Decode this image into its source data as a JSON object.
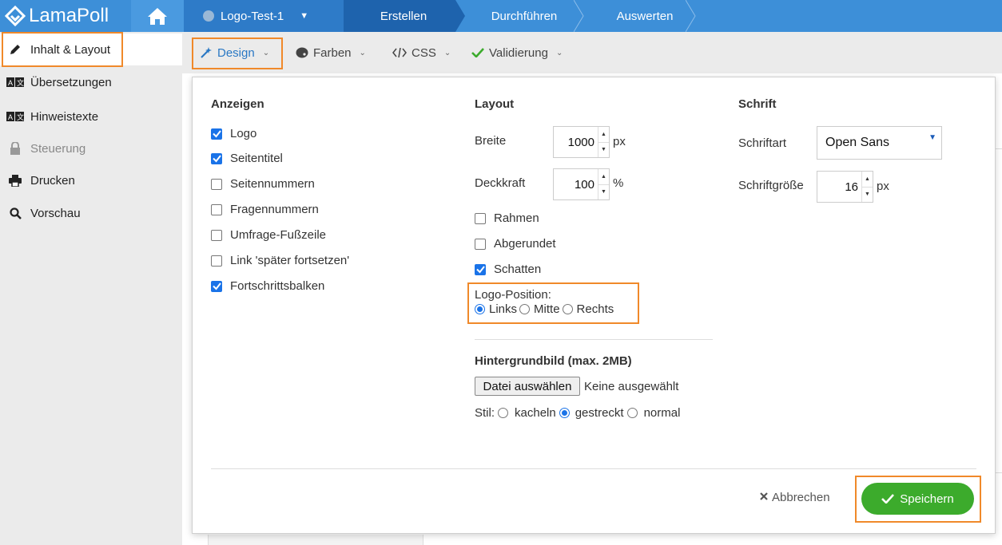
{
  "app": {
    "logo_text": "LamaPoll"
  },
  "breadcrumb": {
    "survey": "Logo-Test-1",
    "steps": [
      "Erstellen",
      "Durchführen",
      "Auswerten"
    ]
  },
  "sidebar": {
    "items": [
      {
        "label": "Inhalt & Layout",
        "icon": "pencil-icon"
      },
      {
        "label": "Übersetzungen",
        "icon": "translate-icon"
      },
      {
        "label": "Hinweistexte",
        "icon": "translate-icon"
      },
      {
        "label": "Steuerung",
        "icon": "lock-icon"
      },
      {
        "label": "Drucken",
        "icon": "printer-icon"
      },
      {
        "label": "Vorschau",
        "icon": "search-icon"
      }
    ]
  },
  "tools": {
    "design": "Design",
    "farben": "Farben",
    "css": "CSS",
    "validierung": "Validierung"
  },
  "anzeigen": {
    "heading": "Anzeigen",
    "options": [
      {
        "label": "Logo",
        "checked": true
      },
      {
        "label": "Seitentitel",
        "checked": true
      },
      {
        "label": "Seitennummern",
        "checked": false
      },
      {
        "label": "Fragennummern",
        "checked": false
      },
      {
        "label": "Umfrage-Fußzeile",
        "checked": false
      },
      {
        "label": "Link 'später fortsetzen'",
        "checked": false
      },
      {
        "label": "Fortschrittsbalken",
        "checked": true
      }
    ]
  },
  "layout": {
    "heading": "Layout",
    "breite_label": "Breite",
    "breite_value": "1000",
    "breite_unit": "px",
    "deckkraft_label": "Deckkraft",
    "deckkraft_value": "100",
    "deckkraft_unit": "%",
    "checks": [
      {
        "label": "Rahmen",
        "checked": false
      },
      {
        "label": "Abgerundet",
        "checked": false
      },
      {
        "label": "Schatten",
        "checked": true
      }
    ],
    "logo_position_label": "Logo-Position:",
    "logo_position_options": [
      "Links",
      "Mitte",
      "Rechts"
    ],
    "logo_position_selected": "Links",
    "hintergrund_heading": "Hintergrundbild (max. 2MB)",
    "file_button": "Datei auswählen",
    "file_status": "Keine ausgewählt",
    "stil_label": "Stil:",
    "stil_options": [
      "kacheln",
      "gestreckt",
      "normal"
    ],
    "stil_selected": "gestreckt"
  },
  "schrift": {
    "heading": "Schrift",
    "schriftart_label": "Schriftart",
    "schriftart_value": "Open Sans",
    "groesse_label": "Schriftgröße",
    "groesse_value": "16",
    "groesse_unit": "px"
  },
  "footer": {
    "cancel": "Abbrechen",
    "save": "Speichern"
  },
  "colors": {
    "topbar": "#3d8fd8",
    "active_step": "#1e63ad",
    "highlight": "#f0892a",
    "save": "#3cab2c",
    "checkbox": "#1a73e8"
  }
}
